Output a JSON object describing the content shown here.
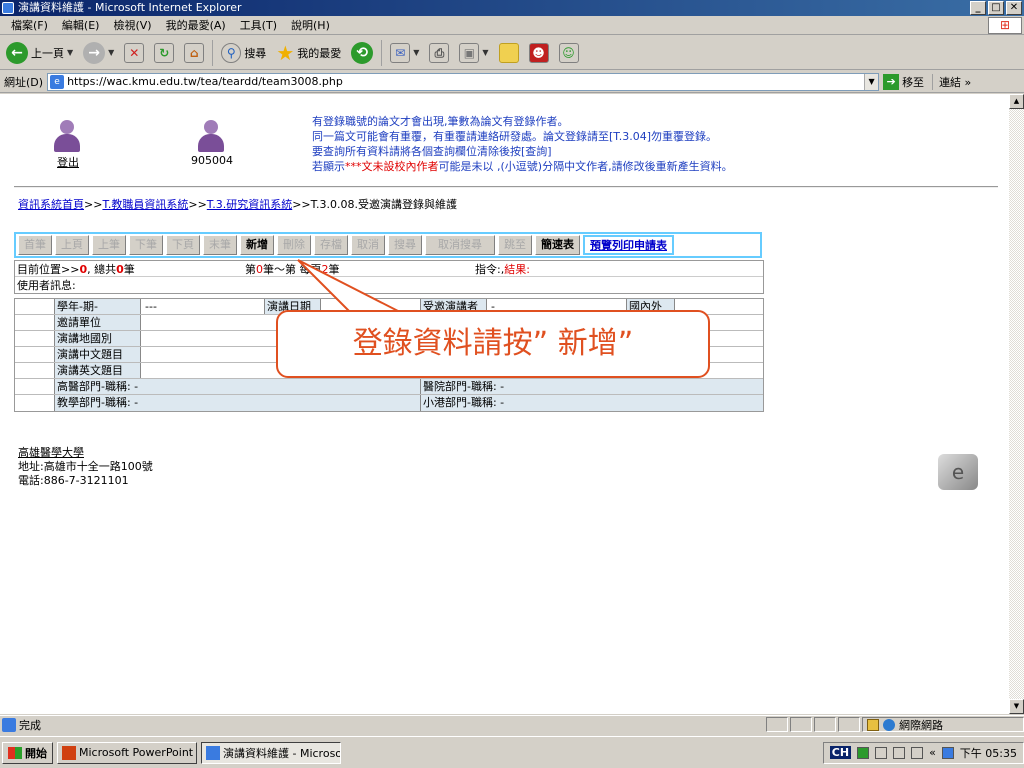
{
  "window": {
    "title": "演講資料維護 - Microsoft Internet Explorer",
    "min": "_",
    "max": "□",
    "close": "✕"
  },
  "menu": [
    "檔案(F)",
    "編輯(E)",
    "檢視(V)",
    "我的最愛(A)",
    "工具(T)",
    "說明(H)"
  ],
  "toolbar": {
    "back": "上一頁",
    "search": "搜尋",
    "favorites": "我的最愛"
  },
  "address": {
    "label": "網址(D)",
    "url": "https://wac.kmu.edu.tw/tea/teardd/team3008.php",
    "go": "移至",
    "links": "連結"
  },
  "header": {
    "logout": "登出",
    "user_id": "905004",
    "notes": [
      "有登錄職號的論文才會出現,筆數為論文有登錄作者。",
      "同一篇文可能會有重覆，有重覆請連絡研發處。論文登錄請至[T.3.04]勿重覆登錄。",
      "要查詢所有資料請將各個查詢欄位清除後按[查詢]"
    ],
    "note_last_pre": "若顯示",
    "note_last_red": "***文未設校內作者",
    "note_last_post": "可能是未以 ,(小逗號)分隔中文作者,請修改後重新產生資料。"
  },
  "breadcrumb": {
    "home": "資訊系統首頁",
    "l1": "T.教職員資訊系統",
    "l2": "T.3.研究資訊系統",
    "sep": ">>",
    "current": ">>T.3.0.08.受邀演講登錄與維護"
  },
  "buttons": [
    "首筆",
    "上頁",
    "上筆",
    "下筆",
    "下頁",
    "末筆",
    "新增",
    "刪除",
    "存檔",
    "取消",
    "搜尋",
    "取消搜尋",
    "跳至",
    "簡速表",
    "預覽列印申請表"
  ],
  "status": {
    "pos_label": "目前位置>>",
    "pos_value": "0",
    "total_label": ", 總共",
    "total_value": "0",
    "total_unit": "筆",
    "range_a": "第",
    "range_b": "0",
    "range_c": "筆～第",
    "range_d": "每頁",
    "range_e": "2",
    "range_f": "筆",
    "cmd_label": "指令:,",
    "result_label": "結果:",
    "user_msg": "使用者訊息:"
  },
  "form": {
    "term_label": "學年-期-",
    "term_value": "---",
    "date_label": "演講日期",
    "speaker_label": "受邀演講者",
    "speaker_value": "-",
    "domestic_label": "國內外",
    "inviter_label": "邀請單位",
    "region_label": "演講地國別",
    "title_zh_label": "演講中文題目",
    "title_en_label": "演講英文題目",
    "medical_dept": "高醫部門-職稱: -",
    "hospital_dept": "醫院部門-職稱: -",
    "teach_dept": "教學部門-職稱: -",
    "xiaogang_dept": "小港部門-職稱: -"
  },
  "tip": "登錄資料請按” 新增”",
  "footer": {
    "name": "高雄醫學大學",
    "address": "地址:高雄市十全一路100號",
    "phone": "電話:886-7-3121101"
  },
  "statusbar": {
    "text": "完成",
    "zone": "網際網路"
  },
  "taskbar": {
    "start": "開始",
    "task1": "Microsoft PowerPoint - [...",
    "task2": "演講資料維護 - Microso...",
    "ime": "CH",
    "time": "下午 05:35"
  }
}
